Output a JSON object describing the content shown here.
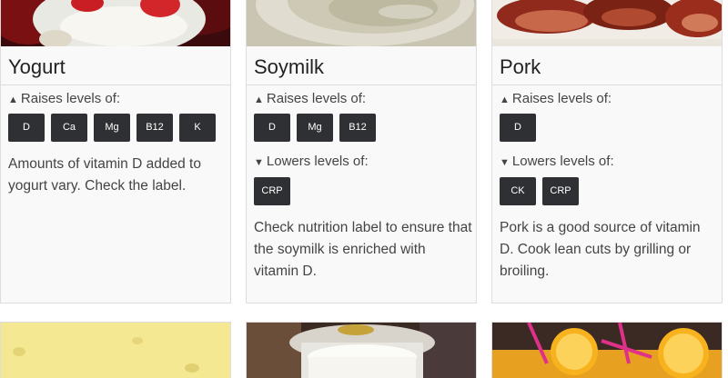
{
  "cards": [
    {
      "title": "Yogurt",
      "raises_label": "Raises levels of:",
      "raises": [
        "D",
        "Ca",
        "Mg",
        "B12",
        "K"
      ],
      "description": "Amounts of vitamin D added to yogurt vary. Check the label."
    },
    {
      "title": "Soymilk",
      "raises_label": "Raises levels of:",
      "raises": [
        "D",
        "Mg",
        "B12"
      ],
      "lowers_label": "Lowers levels of:",
      "lowers": [
        "CRP"
      ],
      "description": "Check nutrition label to ensure that the soymilk is enriched with vitamin D."
    },
    {
      "title": "Pork",
      "raises_label": "Raises levels of:",
      "raises": [
        "D"
      ],
      "lowers_label": "Lowers levels of:",
      "lowers": [
        "CK",
        "CRP"
      ],
      "description": "Pork is a good source of vitamin D. Cook lean cuts by grilling or broiling."
    }
  ],
  "icons": {
    "raises": "triangle-up-icon",
    "lowers": "triangle-down-icon"
  }
}
